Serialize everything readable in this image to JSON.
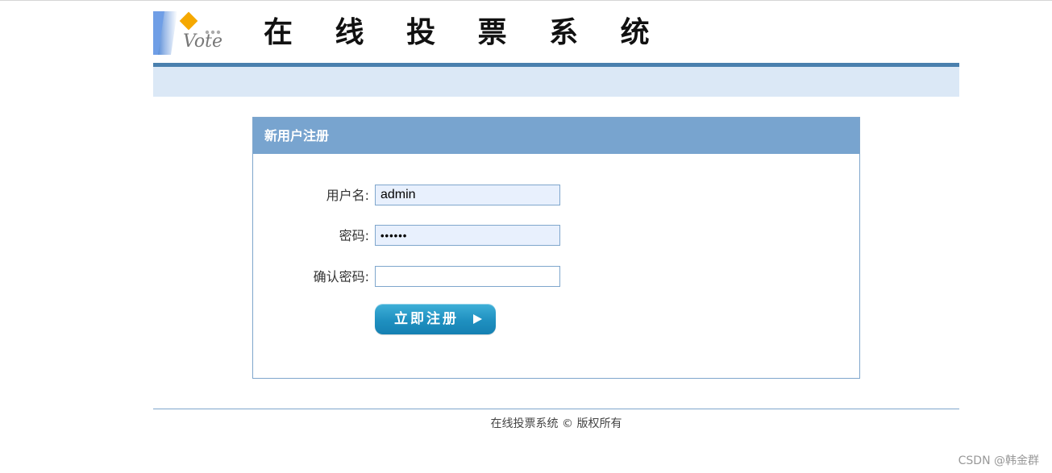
{
  "site": {
    "title": "在 线 投 票 系 统",
    "logo_text": "Vote"
  },
  "panel": {
    "heading": "新用户注册",
    "username_label": "用户名:",
    "username_value": "admin",
    "password_label": "密码:",
    "password_value": "••••••",
    "confirm_label": "确认密码:",
    "confirm_value": "",
    "submit_label": "立即注册"
  },
  "footer": {
    "copyright": "在线投票系统 © 版权所有"
  },
  "watermark": "CSDN @韩金群",
  "colors": {
    "accent": "#4a80ae",
    "panel_header": "#78a4cf",
    "nav_band": "#dbe8f6",
    "button": "#1f90c0"
  }
}
